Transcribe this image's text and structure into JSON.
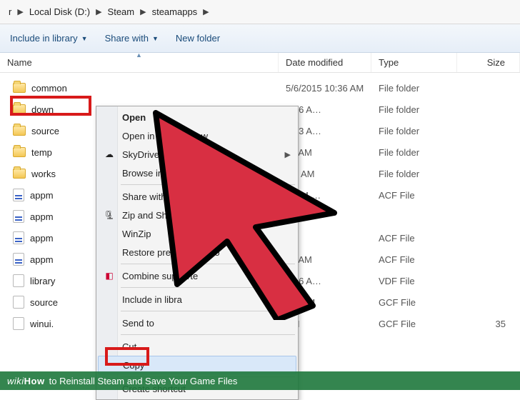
{
  "breadcrumb": [
    "r",
    "Local Disk (D:)",
    "Steam",
    "steamapps"
  ],
  "toolbar": {
    "include": "Include in library",
    "share": "Share with",
    "newfolder": "New folder"
  },
  "columns": {
    "name": "Name",
    "date": "Date modified",
    "type": "Type",
    "size": "Size"
  },
  "files": [
    {
      "name": "common",
      "icon": "folder",
      "date": "5/6/2015 10:36 AM",
      "type": "File folder",
      "size": ""
    },
    {
      "name": "down",
      "icon": "folder",
      "date": "0:46 A…",
      "type": "File folder",
      "size": ""
    },
    {
      "name": "source",
      "icon": "folder",
      "date": "1:13 A…",
      "type": "File folder",
      "size": ""
    },
    {
      "name": "temp",
      "icon": "folder",
      "date": "36 AM",
      "type": "File folder",
      "size": ""
    },
    {
      "name": "works",
      "icon": "folder",
      "date": ":45 AM",
      "type": "File folder",
      "size": ""
    },
    {
      "name": "appm",
      "icon": "acf",
      "date": "10:04 …",
      "type": "ACF File",
      "size": ""
    },
    {
      "name": "appm",
      "icon": "acf",
      "date": "",
      "type": "",
      "size": ""
    },
    {
      "name": "appm",
      "icon": "acf",
      "date": "",
      "type": "ACF File",
      "size": ""
    },
    {
      "name": "appm",
      "icon": "acf",
      "date": "52 AM",
      "type": "ACF File",
      "size": ""
    },
    {
      "name": "library",
      "icon": "file",
      "date": "0:46 A…",
      "type": "VDF File",
      "size": ""
    },
    {
      "name": "source",
      "icon": "file",
      "date": ":43 PM",
      "type": "GCF File",
      "size": ""
    },
    {
      "name": "winui.",
      "icon": "file",
      "date": "AM",
      "type": "GCF File",
      "size": "35"
    }
  ],
  "menu": {
    "open": "Open",
    "open_new_window": "Open in new window",
    "skydrive": "SkyDrive Pro",
    "adobe_bridge": "Browse in Adobe Bridge CS6",
    "share_with": "Share with",
    "zip_share": "Zip and Share (WinZip Exp",
    "winzip": "WinZip",
    "restore": "Restore previous versio",
    "combine": "Combine supporte",
    "include_lib": "Include in libra",
    "send_to": "Send to",
    "cut": "Cut",
    "copy": "Copy",
    "create_shortcut": "Create shortcut"
  },
  "footer": {
    "brand_w": "wiki",
    "brand_h": "How",
    "title": " to Reinstall Steam and Save Your Game Files"
  }
}
